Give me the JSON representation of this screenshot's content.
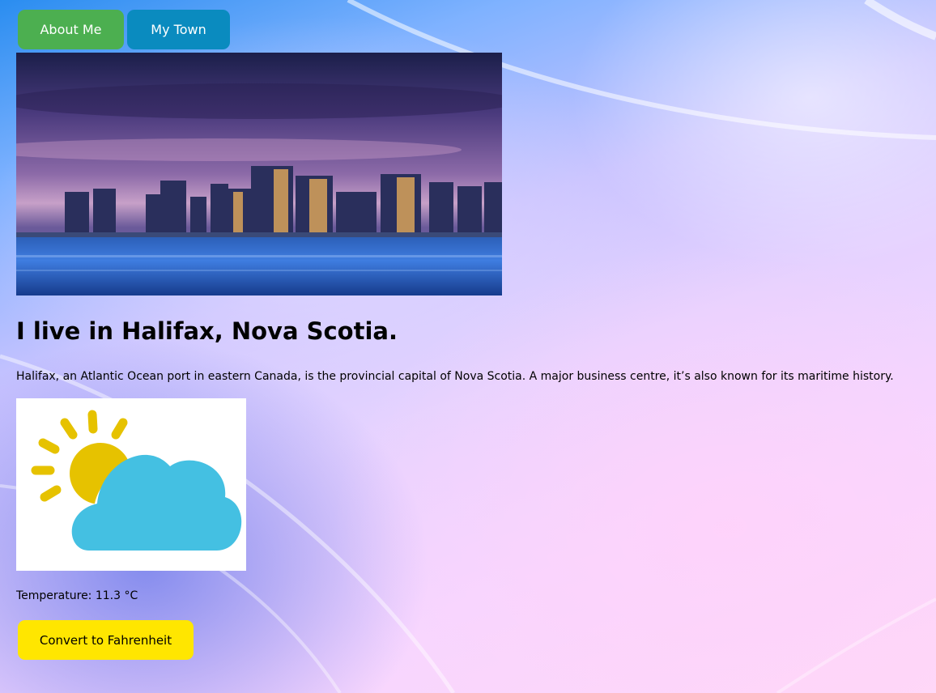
{
  "nav": {
    "about_label": "About Me",
    "town_label": "My Town"
  },
  "town": {
    "headline": "I live in Halifax, Nova Scotia.",
    "description": "Halifax, an Atlantic Ocean port in eastern Canada, is the provincial capital of Nova Scotia. A major business centre, it’s also known for its maritime history."
  },
  "weather": {
    "icon": "partly-cloudy-icon",
    "temperature_text": "Temperature: 11.3 °C",
    "convert_label": "Convert to Fahrenheit"
  },
  "colors": {
    "about_button": "#4caf50",
    "town_button": "#0a8bbf",
    "convert_button": "#ffe600",
    "sun": "#e6c200",
    "cloud": "#44c0e2"
  }
}
